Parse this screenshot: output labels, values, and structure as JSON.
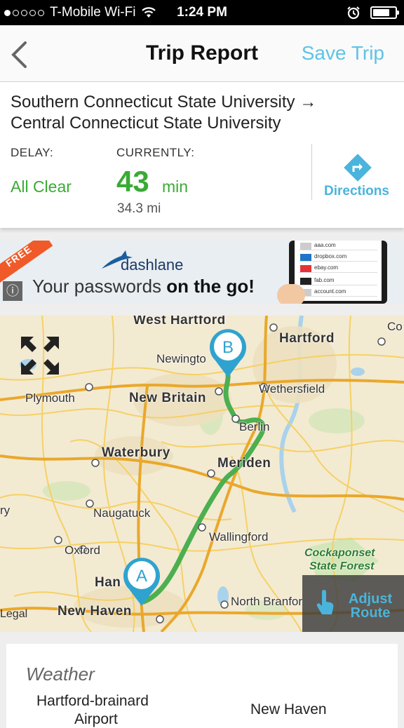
{
  "status_bar": {
    "carrier": "T-Mobile Wi-Fi",
    "time": "1:24 PM",
    "signal_dots_filled": 1,
    "signal_dots_total": 5,
    "battery_level": 0.75
  },
  "nav": {
    "title": "Trip Report",
    "save_label": "Save Trip",
    "back_icon": "chevron-left-icon"
  },
  "trip": {
    "route_line1": "Southern Connecticut State University →",
    "route_line2": "Central Connecticut State University",
    "delay_label": "DELAY:",
    "delay_value": "All Clear",
    "current_label": "CURRENTLY:",
    "current_minutes": "43",
    "current_unit": "min",
    "distance": "34.3 mi",
    "directions_label": "Directions"
  },
  "ad": {
    "badge": "FREE",
    "brand": "dashlane",
    "tagline_prefix": "Your passwords ",
    "tagline_bold": "on the go!",
    "info_icon": "ⓘ",
    "screen_rows": [
      "aaa.com",
      "dropbox.com",
      "ebay.com",
      "fab.com",
      "account.com"
    ]
  },
  "map": {
    "labels": {
      "west_hartford": "West Hartford",
      "hartford": "Hartford",
      "newington": "Newingto",
      "wethersfield": "Wethersfield",
      "plymouth": "Plymouth",
      "new_britain": "New Britain",
      "berlin": "Berlin",
      "waterbury": "Waterbury",
      "meriden": "Meriden",
      "naugatuck": "Naugatuck",
      "wallingford": "Wallingford",
      "oxford": "Oxford",
      "cockaponset1": "Cockaponset",
      "cockaponset2": "State Forest",
      "hamden": "Han",
      "north_branford": "North Branfor",
      "new_haven": "New Haven",
      "co": "Co",
      "ry": "ry"
    },
    "pin_start": "A",
    "pin_end": "B",
    "legal": "Legal",
    "adjust_line1": "Adjust",
    "adjust_line2": "Route",
    "route_color": "#4caf50"
  },
  "weather": {
    "title": "Weather",
    "location1_line1": "Hartford-brainard",
    "location1_line2": "Airport",
    "location2": "New Haven"
  },
  "colors": {
    "accent": "#5ec3e6",
    "green": "#3aaa35"
  }
}
